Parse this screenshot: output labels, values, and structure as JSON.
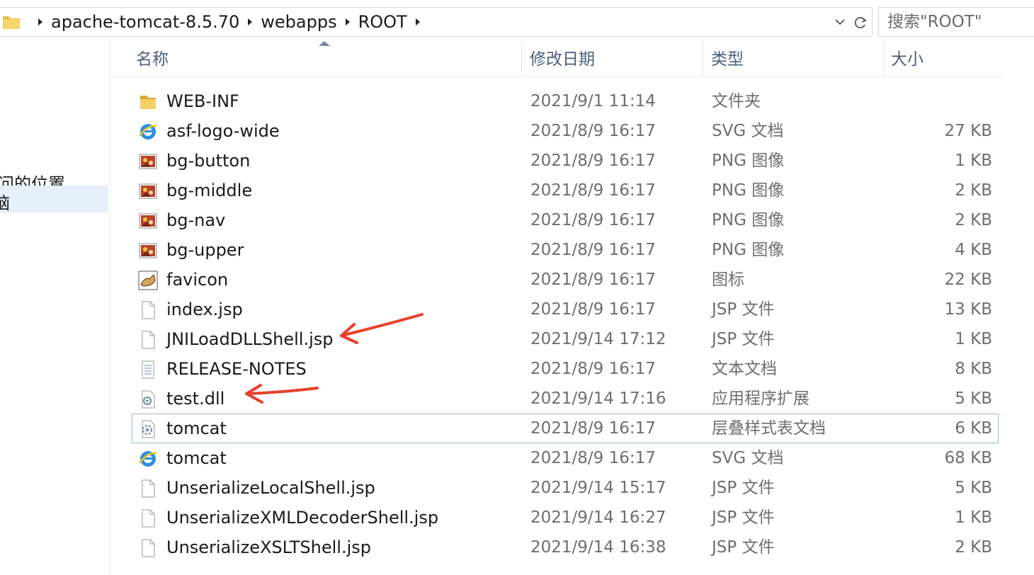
{
  "addressbar": {
    "breadcrumbs": [
      "apache-tomcat-8.5.70",
      "webapps",
      "ROOT"
    ]
  },
  "search": {
    "placeholder": "搜索\"ROOT\""
  },
  "nav": {
    "recent_label": "问的位置",
    "selected_label": "脑"
  },
  "columns": {
    "name": "名称",
    "date": "修改日期",
    "type": "类型",
    "size": "大小"
  },
  "files": [
    {
      "name": "WEB-INF",
      "date": "2021/9/1 11:14",
      "type": "文件夹",
      "size": "",
      "icon": "folder-icon"
    },
    {
      "name": "asf-logo-wide",
      "date": "2021/8/9 16:17",
      "type": "SVG 文档",
      "size": "27 KB",
      "icon": "ie-svg-icon"
    },
    {
      "name": "bg-button",
      "date": "2021/8/9 16:17",
      "type": "PNG 图像",
      "size": "1 KB",
      "icon": "png-image-icon"
    },
    {
      "name": "bg-middle",
      "date": "2021/8/9 16:17",
      "type": "PNG 图像",
      "size": "2 KB",
      "icon": "png-image-icon"
    },
    {
      "name": "bg-nav",
      "date": "2021/8/9 16:17",
      "type": "PNG 图像",
      "size": "2 KB",
      "icon": "png-image-icon"
    },
    {
      "name": "bg-upper",
      "date": "2021/8/9 16:17",
      "type": "PNG 图像",
      "size": "4 KB",
      "icon": "png-image-icon"
    },
    {
      "name": "favicon",
      "date": "2021/8/9 16:17",
      "type": "图标",
      "size": "22 KB",
      "icon": "tomcat-favicon-icon"
    },
    {
      "name": "index.jsp",
      "date": "2021/8/9 16:17",
      "type": "JSP 文件",
      "size": "13 KB",
      "icon": "blank-file-icon"
    },
    {
      "name": "JNILoadDLLShell.jsp",
      "date": "2021/9/14 17:12",
      "type": "JSP 文件",
      "size": "1 KB",
      "icon": "blank-file-icon"
    },
    {
      "name": "RELEASE-NOTES",
      "date": "2021/8/9 16:17",
      "type": "文本文档",
      "size": "8 KB",
      "icon": "text-file-icon"
    },
    {
      "name": "test.dll",
      "date": "2021/9/14 17:16",
      "type": "应用程序扩展",
      "size": "5 KB",
      "icon": "dll-file-icon"
    },
    {
      "name": "tomcat",
      "date": "2021/8/9 16:17",
      "type": "层叠样式表文档",
      "size": "6 KB",
      "icon": "css-file-icon",
      "selected": true
    },
    {
      "name": "tomcat",
      "date": "2021/8/9 16:17",
      "type": "SVG 文档",
      "size": "68 KB",
      "icon": "ie-svg-icon"
    },
    {
      "name": "UnserializeLocalShell.jsp",
      "date": "2021/9/14 15:17",
      "type": "JSP 文件",
      "size": "5 KB",
      "icon": "blank-file-icon"
    },
    {
      "name": "UnserializeXMLDecoderShell.jsp",
      "date": "2021/9/14 16:27",
      "type": "JSP 文件",
      "size": "1 KB",
      "icon": "blank-file-icon"
    },
    {
      "name": "UnserializeXSLTShell.jsp",
      "date": "2021/9/14 16:38",
      "type": "JSP 文件",
      "size": "2 KB",
      "icon": "blank-file-icon"
    }
  ],
  "annotations": [
    {
      "name": "red-arrow",
      "points_to": "JNILoadDLLShell.jsp",
      "color": "#e8402a"
    },
    {
      "name": "red-arrow",
      "points_to": "test.dll",
      "color": "#e8402a"
    }
  ],
  "colors": {
    "header_text": "#4c607a",
    "selection_border": "#99b7d1",
    "nav_selected_bg": "#e5f0fb",
    "arrow": "#e8402a"
  }
}
